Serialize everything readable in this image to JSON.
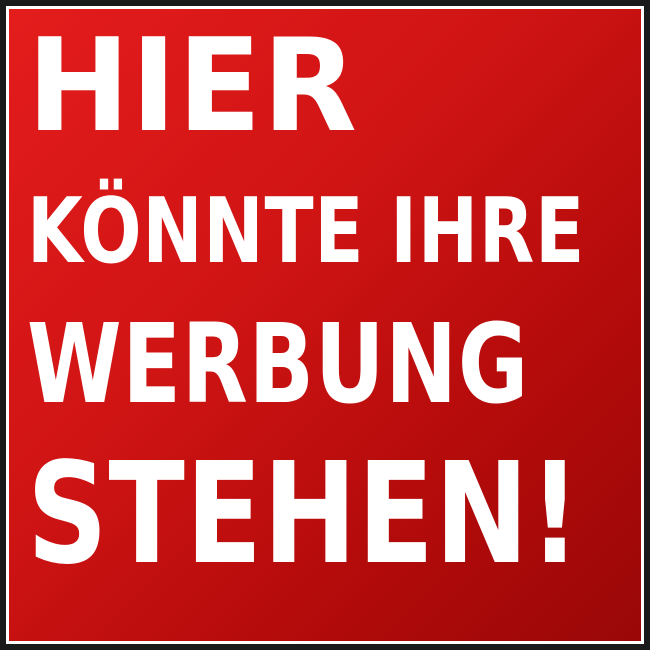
{
  "sign": {
    "line1": "HIER",
    "line2": "KÖNNTE IHRE",
    "line3": "WERBUNG",
    "line4": "STEHEN!"
  },
  "colors": {
    "background_outer": "#1a1a1a",
    "sign_red_light": "#e41c1c",
    "sign_red_dark": "#9a0707",
    "text": "#ffffff",
    "border": "#ffffff"
  }
}
